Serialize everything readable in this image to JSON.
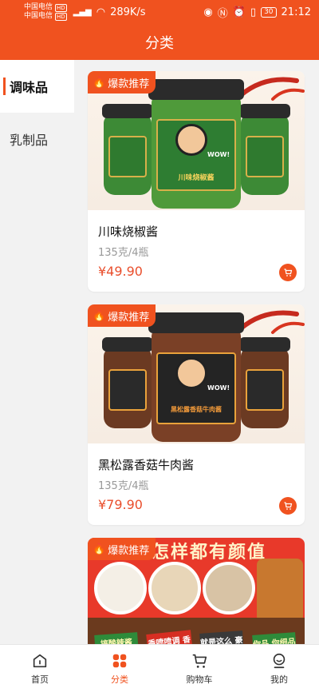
{
  "status": {
    "carrier1": "中国电信",
    "carrier2": "中国电信",
    "hd": "HD",
    "net": "4G",
    "speed": "289K/s",
    "battery": "30",
    "time": "21:12"
  },
  "header": {
    "title": "分类"
  },
  "sidebar": {
    "items": [
      {
        "label": "调味品",
        "active": true
      },
      {
        "label": "乳制品",
        "active": false
      }
    ]
  },
  "products": [
    {
      "badge": "爆款推荐",
      "name": "川味烧椒酱",
      "spec": "135克/4瓶",
      "price": "¥49.90",
      "theme": "green"
    },
    {
      "badge": "爆款推荐",
      "name": "黑松露香菇牛肉酱",
      "spec": "135克/4瓶",
      "price": "¥79.90",
      "theme": "dark"
    },
    {
      "badge": "爆款推荐",
      "name": "",
      "spec": "",
      "price": "",
      "theme": "poster"
    }
  ],
  "poster": {
    "headline": "怎样都有颜值",
    "tags": [
      "搞酸辣酱 770",
      "香喷喷调 香酥啊",
      "就是这么 豪横",
      "你品 你细品"
    ]
  },
  "jar_labels": {
    "green": "川味烧椒酱",
    "dark": "黑松露香菇牛肉酱",
    "wow": "WOW!"
  },
  "bottom_nav": {
    "items": [
      {
        "label": "首页",
        "icon": "home-icon"
      },
      {
        "label": "分类",
        "icon": "category-icon",
        "active": true
      },
      {
        "label": "购物车",
        "icon": "cart-icon"
      },
      {
        "label": "我的",
        "icon": "profile-icon"
      }
    ]
  },
  "colors": {
    "brand": "#f0521f",
    "price": "#e94e2c"
  }
}
